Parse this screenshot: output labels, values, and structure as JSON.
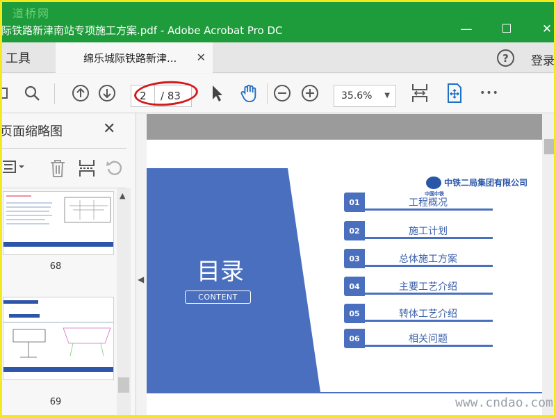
{
  "watermark": {
    "top": "道桥网",
    "bottom": "www.cndao.com"
  },
  "window": {
    "title": "际铁路新津南站专项施工方案.pdf - Adobe Acrobat Pro DC",
    "minimize": "—",
    "maximize": "☐",
    "close": "✕"
  },
  "tabs": {
    "tools": "工具",
    "document": "绵乐城际铁路新津...",
    "close": "✕"
  },
  "header": {
    "help": "?",
    "login": "登录"
  },
  "toolbar": {
    "current_page": "2",
    "total_pages": "/ 83",
    "zoom": "35.6%",
    "more": "•••"
  },
  "panel": {
    "title": "页面缩略图",
    "close": "✕",
    "thumbnails": [
      {
        "page": "68"
      },
      {
        "page": "69"
      }
    ]
  },
  "document": {
    "heading": "目录",
    "subheading": "CONTENT",
    "company": "中铁二局集团有限公司",
    "company_sub": "中国中铁",
    "items": [
      {
        "num": "01",
        "label": "工程概况"
      },
      {
        "num": "02",
        "label": "施工计划"
      },
      {
        "num": "03",
        "label": "总体施工方案"
      },
      {
        "num": "04",
        "label": "主要工艺介绍"
      },
      {
        "num": "05",
        "label": "转体工艺介绍"
      },
      {
        "num": "06",
        "label": "相关问题"
      }
    ]
  },
  "colors": {
    "titlebar": "#1e9b3a",
    "accent": "#4a6fbf",
    "annotation": "#d21a1a"
  }
}
